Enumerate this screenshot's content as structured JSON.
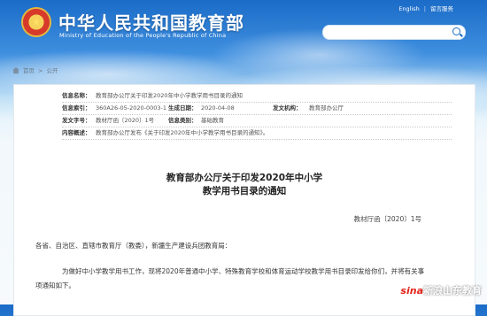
{
  "header": {
    "title": "中华人民共和国教育部",
    "subtitle": "Ministry of Education of the People's Republic of China",
    "links": [
      "English",
      "留言服务"
    ]
  },
  "breadcrumb": [
    "首页",
    "公开"
  ],
  "meta": {
    "name_label": "信息名称：",
    "name_value": "教育部办公厅关于印发2020年中小学教学用书目录的通知",
    "index_label": "信息索引：",
    "index_value": "360A26-05-2020-0003-1",
    "date_label": "生成日期：",
    "date_value": "2020-04-08",
    "org_label": "发文机构：",
    "org_value": "教育部办公厅",
    "docno_label": "发文字号：",
    "docno_value": "教材厅函〔2020〕1号",
    "category_label": "信息类别：",
    "category_value": "基础教育",
    "summary_label": "内容概述：",
    "summary_value": "教育部办公厅发布《关于印发2020年中小学教学用书目录的通知》。"
  },
  "document": {
    "title_line1": "教育部办公厅关于印发2020年中小学",
    "title_line2": "教学用书目录的通知",
    "number": "教材厅函〔2020〕1号",
    "salutation": "各省、自治区、直辖市教育厅（教委），新疆生产建设兵团教育局：",
    "body": "为做好中小学教学用书工作，现将2020年普通中小学、特殊教育学校和体育运动学校教学用书目录印发给你们，并将有关事项通知如下。"
  },
  "watermark": {
    "brand": "sina",
    "text": "新浪山东教育"
  }
}
